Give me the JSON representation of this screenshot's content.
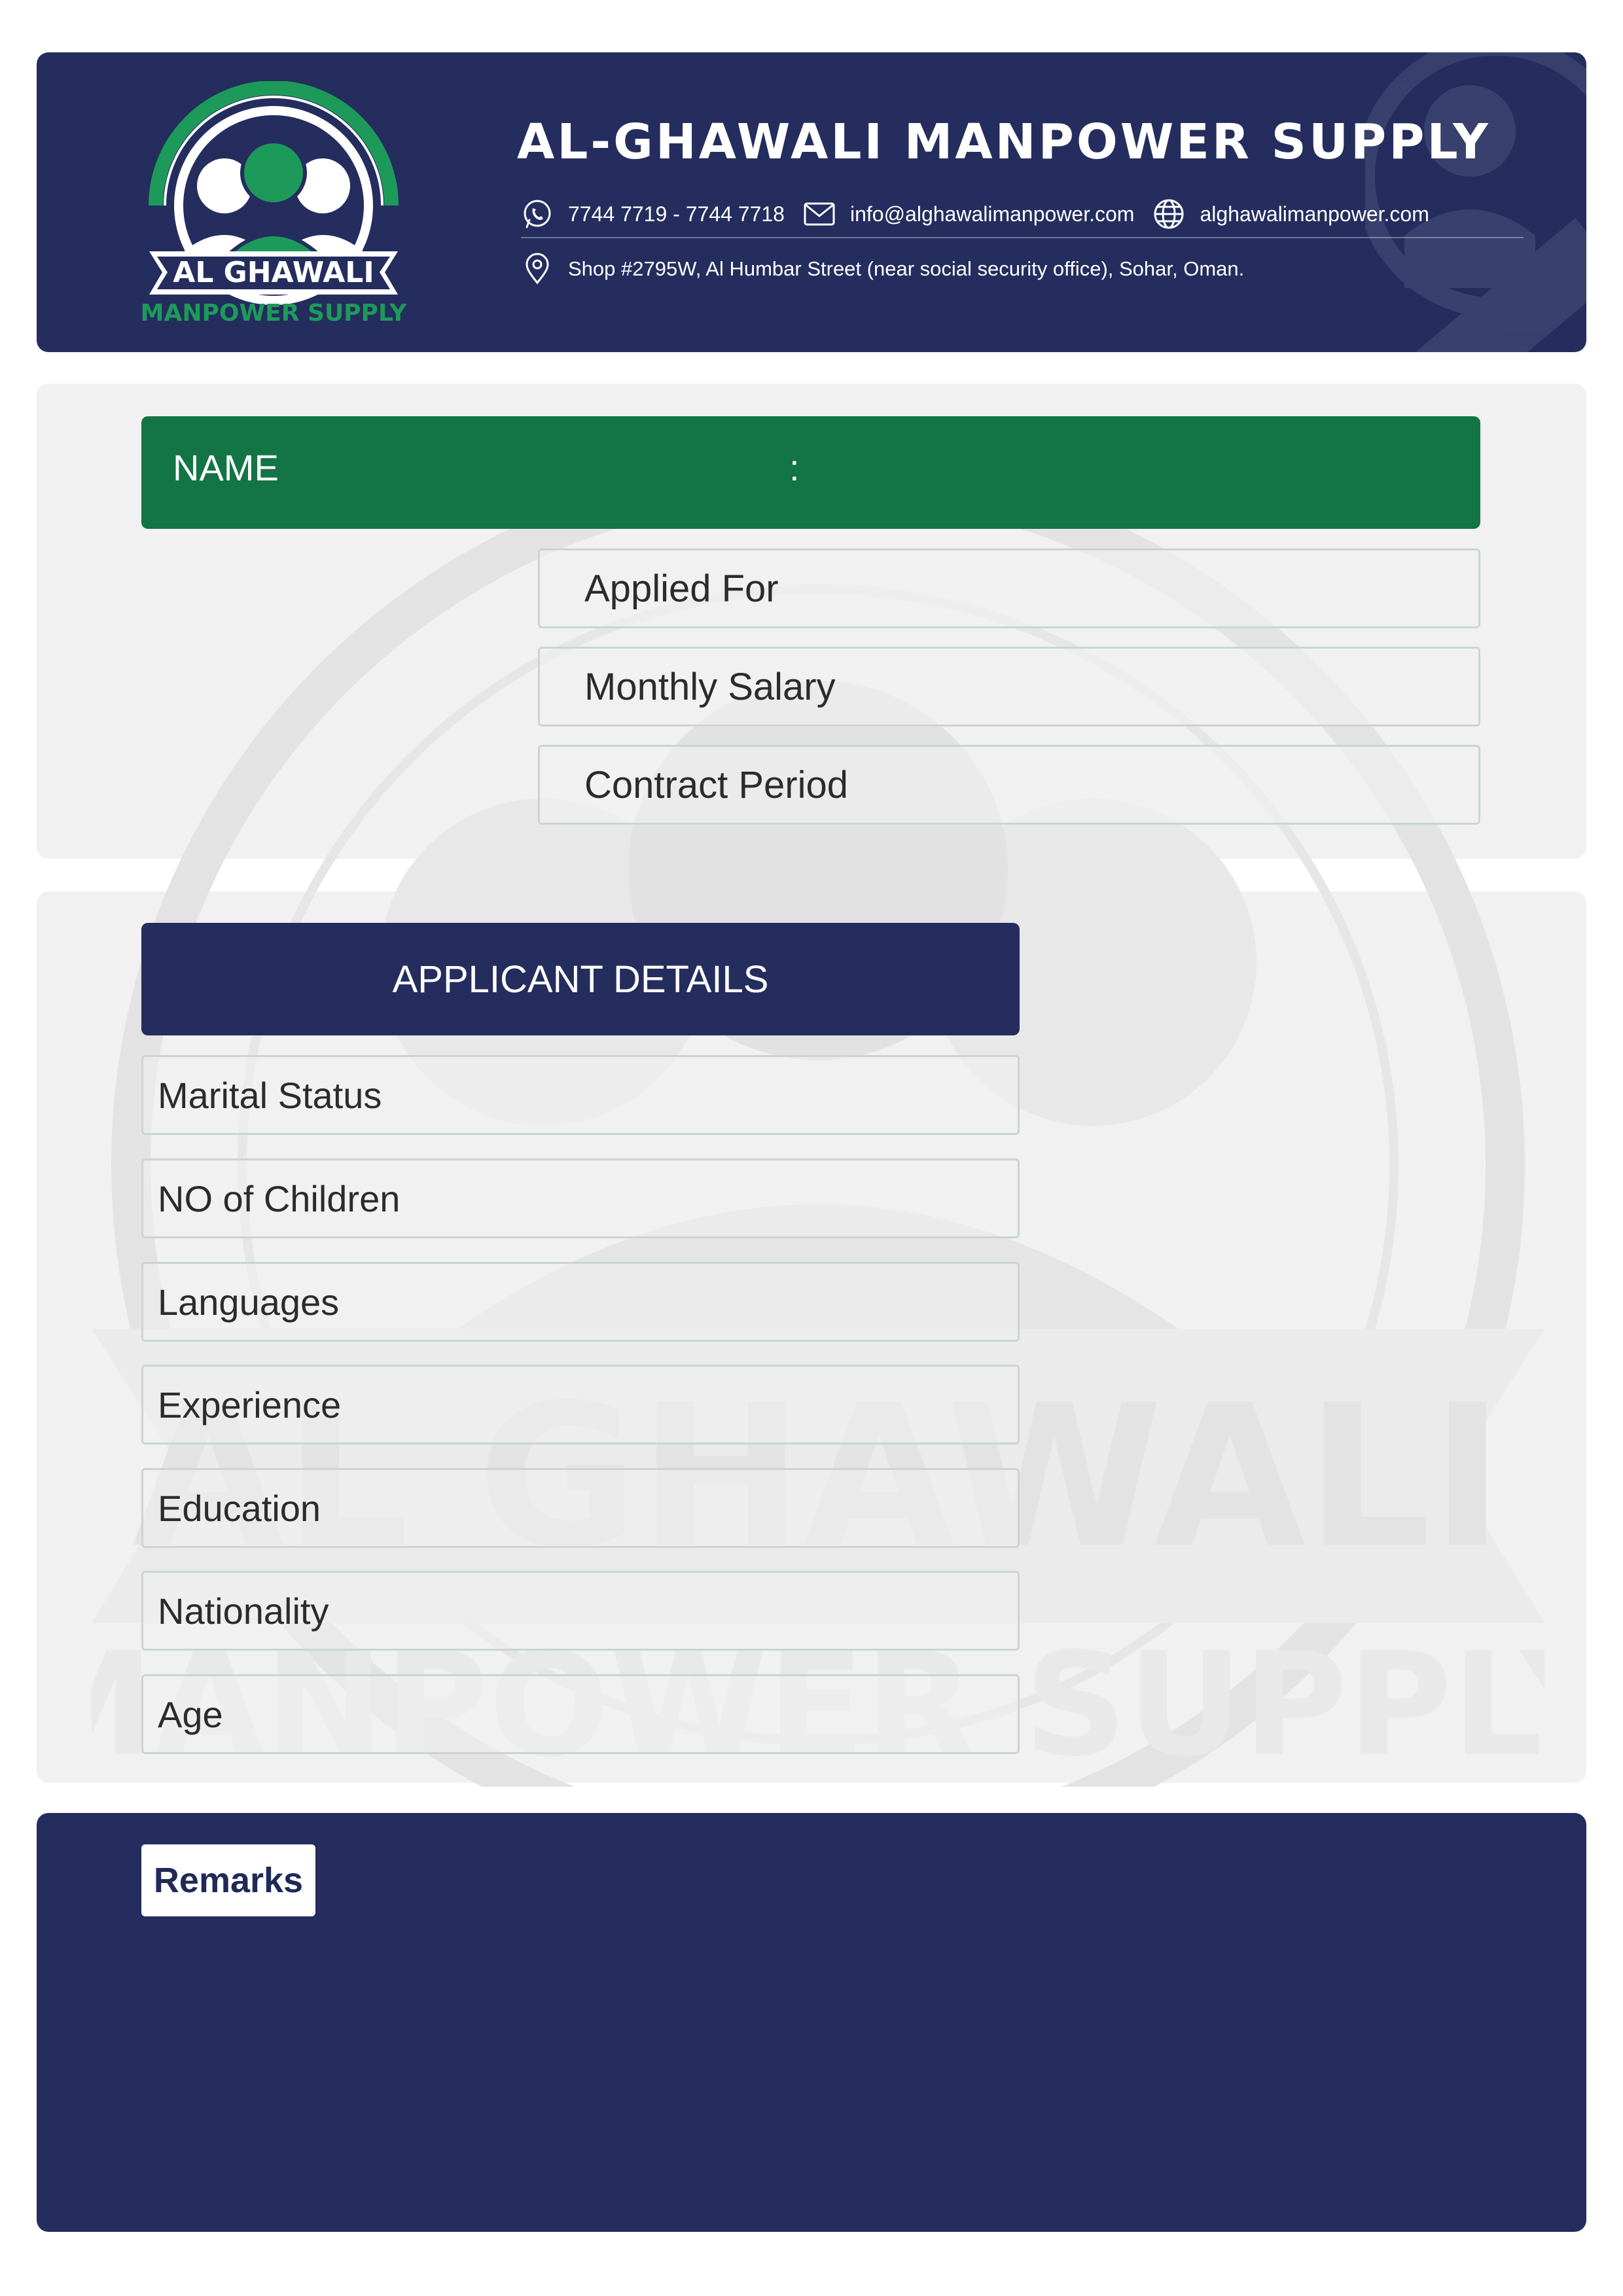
{
  "header": {
    "company_name": "AL-GHAWALI MANPOWER SUPPLY",
    "logo": {
      "line1": "AL GHAWALI",
      "line2": "MANPOWER SUPPLY"
    },
    "phone": "7744 7719 - 7744 7718",
    "email": "info@alghawalimanpower.com",
    "website": "alghawalimanpower.com",
    "address": "Shop #2795W, Al Humbar Street (near social security office), Sohar, Oman.",
    "icons": [
      "whatsapp-icon",
      "mail-icon",
      "globe-icon",
      "location-pin-icon"
    ]
  },
  "name_bar": {
    "label": "NAME",
    "separator": ":"
  },
  "job_fields": [
    {
      "label": "Applied For"
    },
    {
      "label": "Monthly Salary"
    },
    {
      "label": "Contract Period"
    }
  ],
  "applicant_details": {
    "title": "APPLICANT DETAILS",
    "fields": [
      {
        "label": "Marital Status"
      },
      {
        "label": "NO of Children"
      },
      {
        "label": "Languages"
      },
      {
        "label": "Experience"
      },
      {
        "label": "Education"
      },
      {
        "label": "Nationality"
      },
      {
        "label": "Age"
      }
    ]
  },
  "remarks": {
    "label": "Remarks"
  },
  "watermark": {
    "line1": "AL GHAWALI",
    "line2": "MANPOWER SUPPLY"
  },
  "colors": {
    "navy": "#242d5e",
    "green": "#137445",
    "panel": "#f1f1f1",
    "logo_green": "#1d9a5a"
  }
}
